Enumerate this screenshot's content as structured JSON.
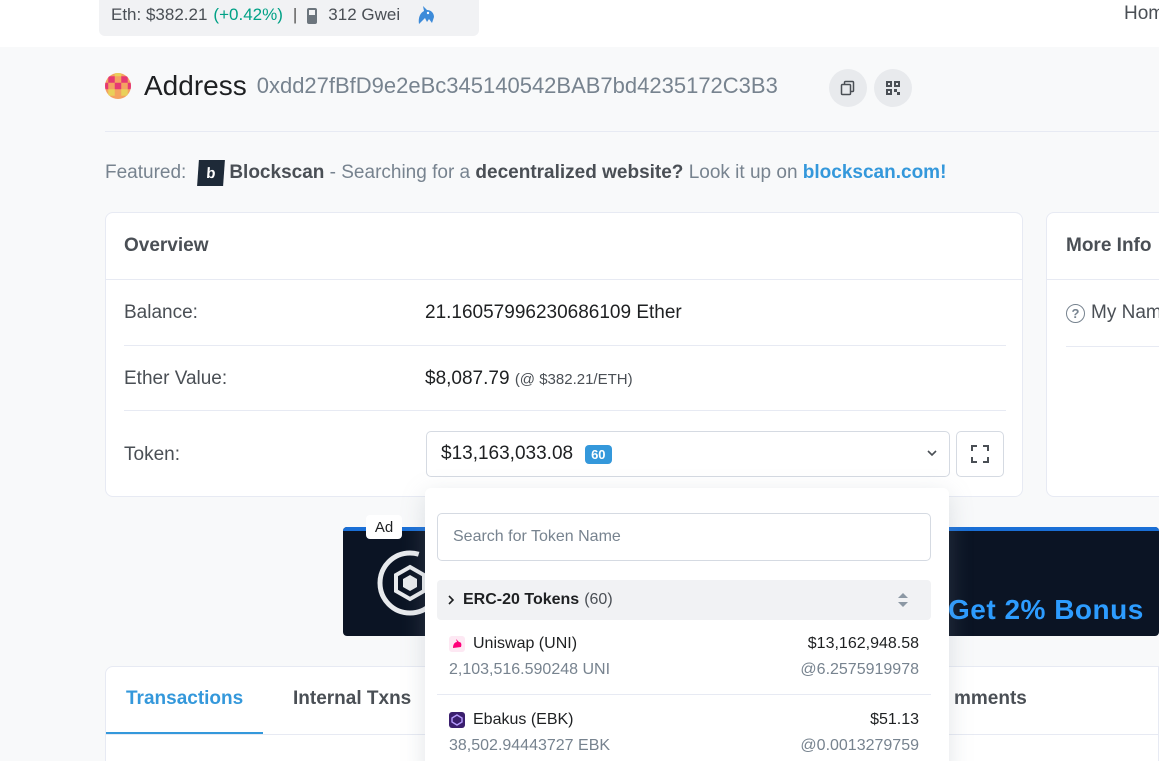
{
  "topbar": {
    "eth_price": "Eth: $382.21",
    "eth_change": "(+0.42%)",
    "separator": "|",
    "gas": "312 Gwei",
    "home_link": "Hom"
  },
  "address": {
    "title": "Address",
    "hash": "0xdd27fBfD9e2eBc345140542BAB7bd4235172C3B3"
  },
  "featured": {
    "prefix": "Featured:",
    "brand": "Blockscan",
    "logo_letter": "b",
    "text1": " - Searching for a ",
    "bold_text": "decentralized website?",
    "text2": " Look it up on ",
    "link": "blockscan.com!"
  },
  "overview": {
    "header": "Overview",
    "balance_label": "Balance:",
    "balance_value": "21.16057996230686109 Ether",
    "ether_value_label": "Ether Value:",
    "ether_value": "$8,087.79",
    "ether_rate": "(@ $382.21/ETH)",
    "token_label": "Token:",
    "token_value": "$13,163,033.08",
    "token_count": "60"
  },
  "more_info": {
    "header": "More Info",
    "my_name": "My Nam",
    "help_glyph": "?"
  },
  "ad": {
    "label": "Ad",
    "bonus_text": "Get 2% Bonus"
  },
  "tabs": {
    "transactions": "Transactions",
    "internal": "Internal Txns",
    "comments_partial": "mments"
  },
  "dropdown": {
    "search_placeholder": "Search for Token Name",
    "group_title": "ERC-20 Tokens",
    "group_count": "(60)",
    "tokens": [
      {
        "name": "Uniswap (UNI)",
        "usd": "$13,162,948.58",
        "qty": "2,103,516.590248 UNI",
        "rate": "@6.2575919978",
        "icon": "uniswap-token-icon"
      },
      {
        "name": "Ebakus (EBK)",
        "usd": "$51.13",
        "qty": "38,502.94443727 EBK",
        "rate": "@0.0013279759",
        "icon": "ebakus-token-icon"
      }
    ]
  },
  "colors": {
    "accent": "#3498db",
    "positive": "#00a186",
    "ad_bonus": "#2d9cff"
  }
}
